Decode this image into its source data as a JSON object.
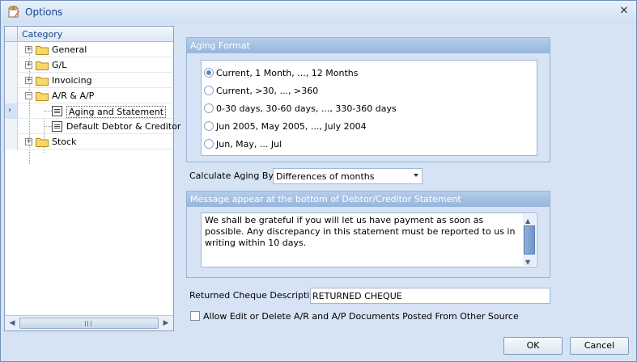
{
  "window": {
    "title": "Options",
    "icon": "options-app-icon"
  },
  "tree": {
    "header": "Category",
    "items": [
      {
        "label": "General",
        "level": 0,
        "expander": "+"
      },
      {
        "label": "G/L",
        "level": 0,
        "expander": "+"
      },
      {
        "label": "Invoicing",
        "level": 0,
        "expander": "+"
      },
      {
        "label": "A/R & A/P",
        "level": 0,
        "expander": "−"
      },
      {
        "label": "Aging and Statement",
        "level": 1
      },
      {
        "label": "Default Debtor & Creditor",
        "level": 1
      },
      {
        "label": "Stock",
        "level": 0,
        "expander": "+"
      }
    ]
  },
  "aging_format": {
    "header": "Aging Format",
    "options": [
      "Current, 1 Month, ..., 12 Months",
      "Current, >30, ..., >360",
      "0-30 days, 30-60 days, ..., 330-360 days",
      "Jun 2005, May 2005, ..., July 2004",
      "Jun, May, ... Jul"
    ],
    "selected_index": 0
  },
  "calc_aging": {
    "label": "Calculate Aging By:",
    "value": "Differences of months"
  },
  "message": {
    "header": "Message appear at the bottom of Debtor/Creditor Statement",
    "text": "We shall be grateful if you will let us have payment as soon as possible. Any discrepancy in this statement must be reported to us in writing within 10 days."
  },
  "returned_cheque": {
    "label": "Returned Cheque Description",
    "value": "RETURNED CHEQUE"
  },
  "allow_edit": {
    "label": "Allow Edit or Delete A/R and A/P Documents Posted From Other Source",
    "checked": false
  },
  "buttons": {
    "ok": "OK",
    "cancel": "Cancel"
  },
  "colors": {
    "title_text": "#15428b",
    "window_bg": "#d5e3f5",
    "radio_checked": "#5b86c6"
  }
}
